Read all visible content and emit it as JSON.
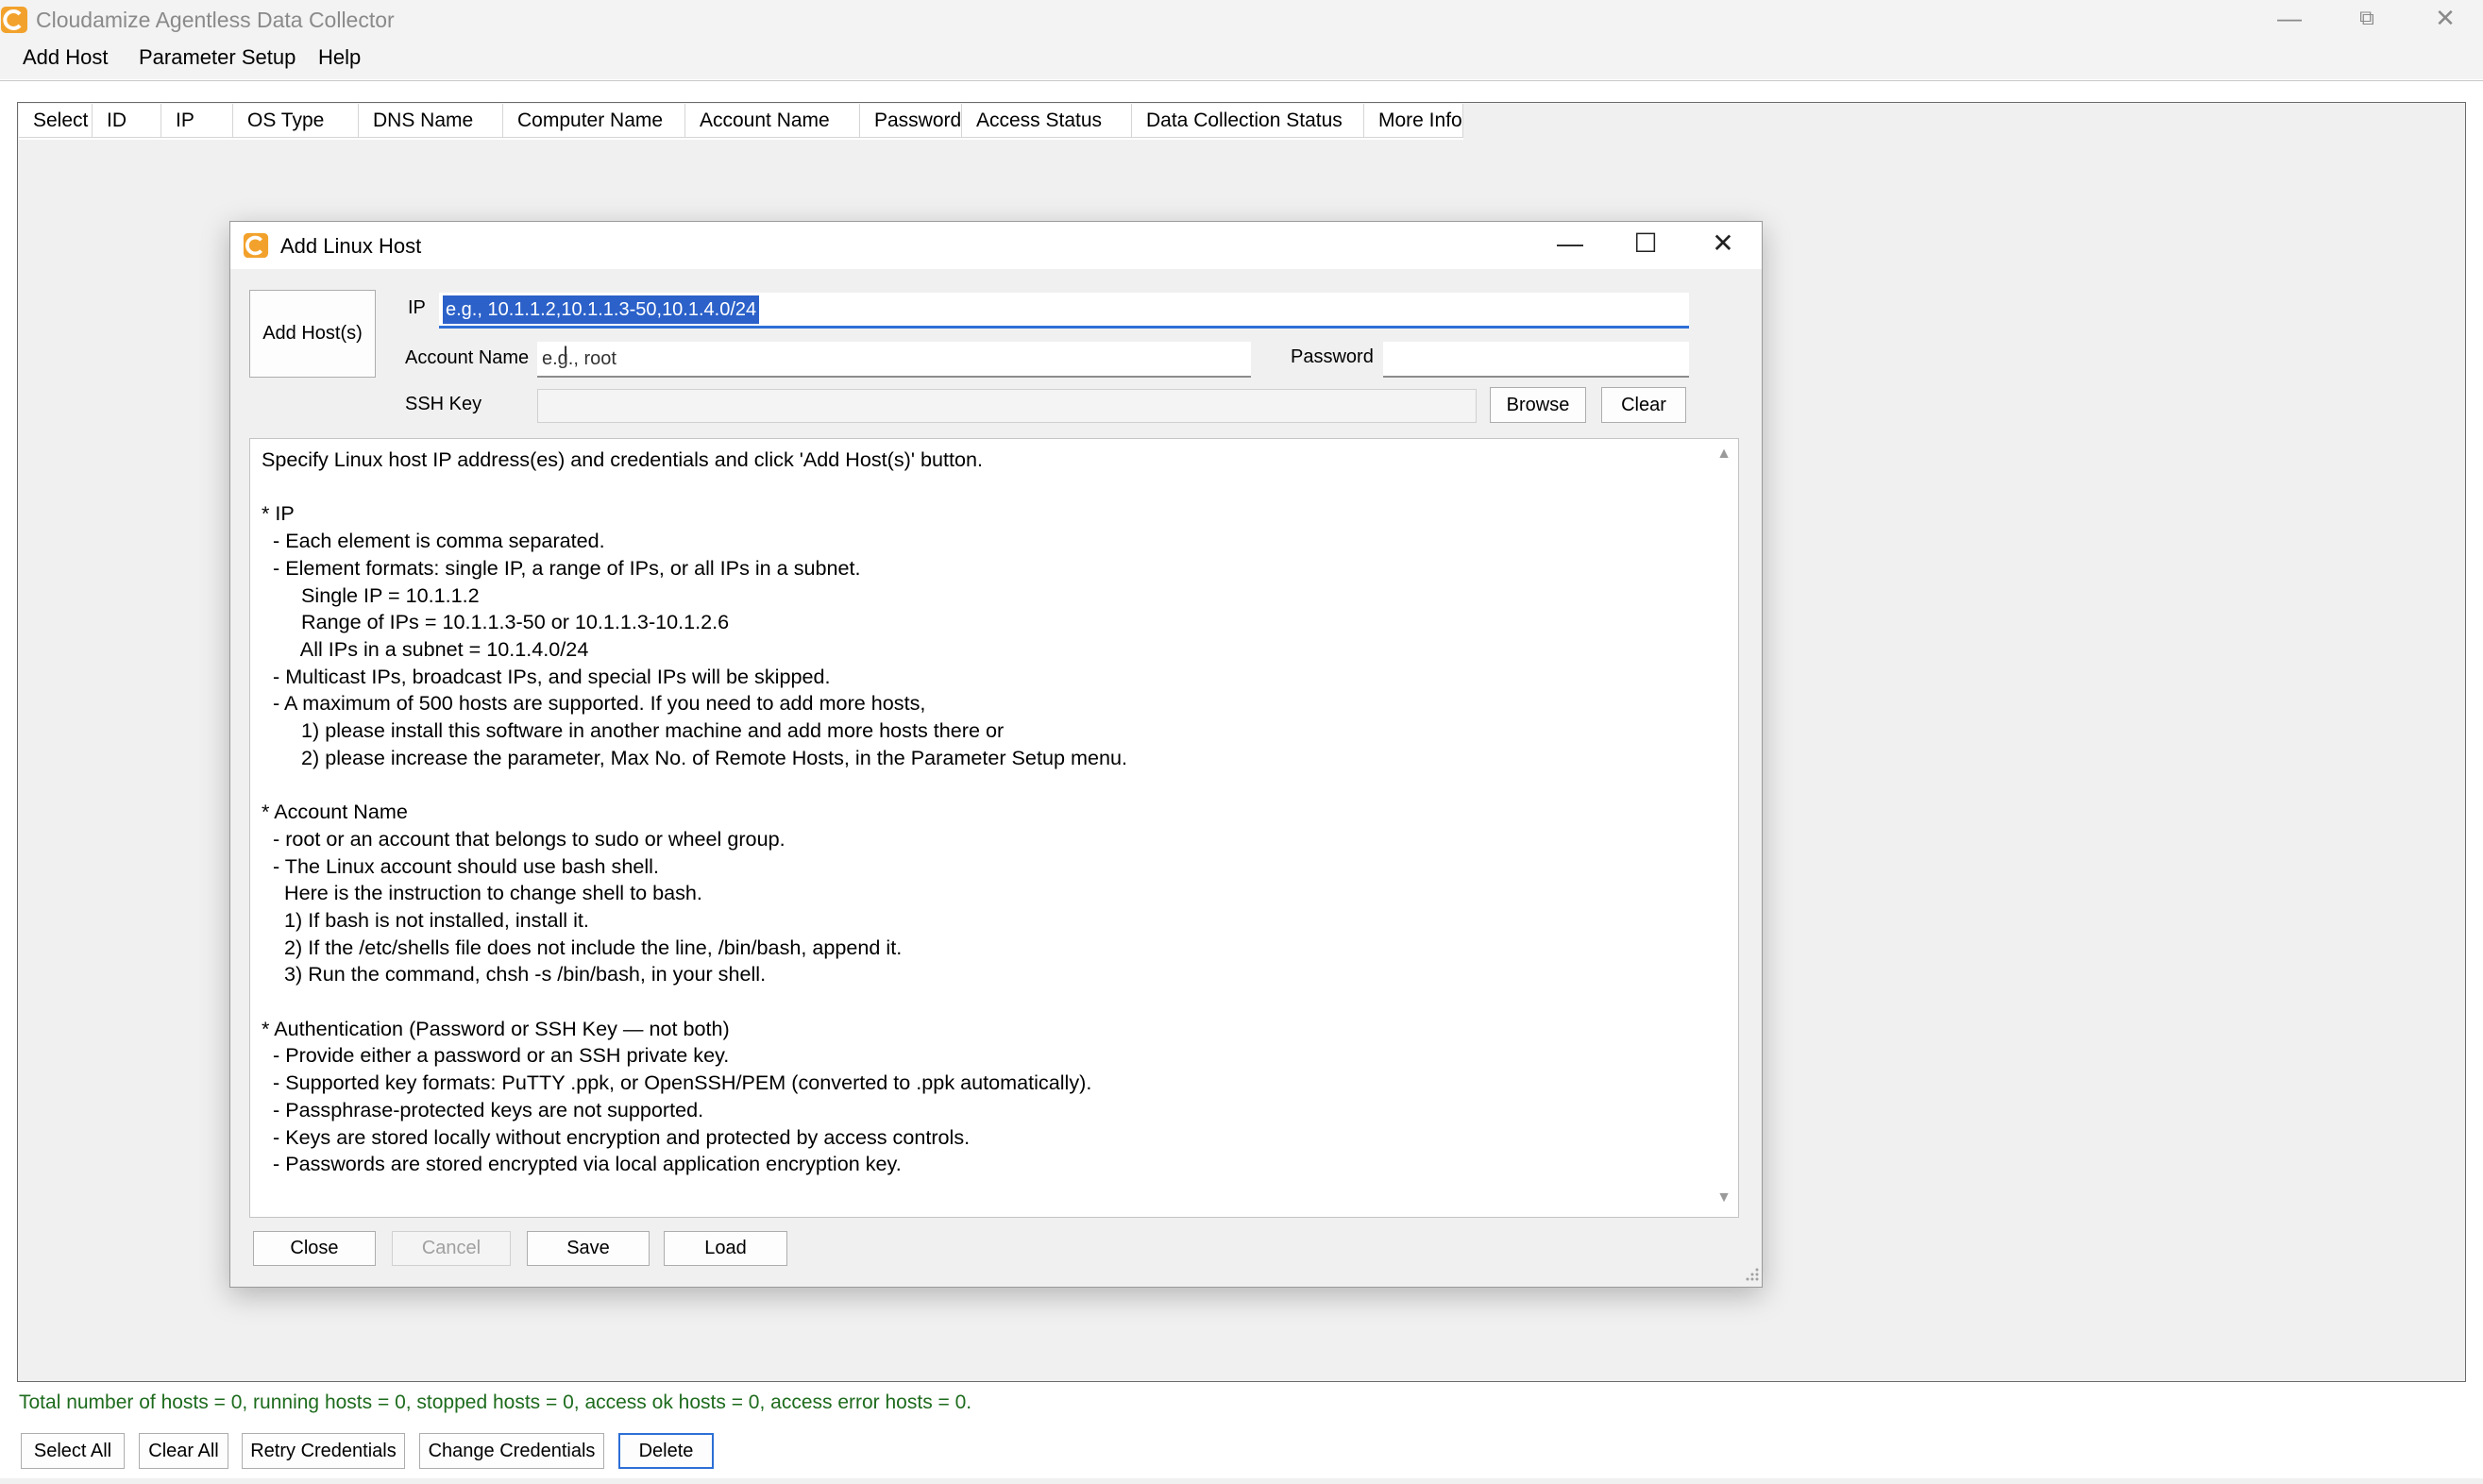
{
  "app": {
    "title": "Cloudamize Agentless Data Collector",
    "window_controls": {
      "minimize": "—",
      "restore": "⧉",
      "close": "✕"
    }
  },
  "menu": [
    "Add Host",
    "Parameter Setup",
    "Help"
  ],
  "grid": {
    "columns": [
      "Select",
      "ID",
      "IP",
      "OS Type",
      "DNS Name",
      "Computer Name",
      "Account Name",
      "Password",
      "Access Status",
      "Data Collection Status",
      "More Info"
    ]
  },
  "status_text": "Total number of hosts = 0, running hosts = 0, stopped hosts = 0, access ok hosts = 0, access error hosts = 0.",
  "bottom_buttons": [
    "Select All",
    "Clear All",
    "Retry Credentials",
    "Change Credentials",
    "Delete"
  ],
  "dialog": {
    "title": "Add Linux Host",
    "add_hosts_button": "Add Host(s)",
    "ip_label": "IP",
    "ip_value": "e.g., 10.1.1.2,10.1.1.3-50,10.1.4.0/24",
    "account_label": "Account Name",
    "account_value": "e.g., root",
    "password_label": "Password",
    "password_value": "",
    "ssh_label": "SSH Key",
    "ssh_value": "",
    "browse_button": "Browse",
    "clear_button": "Clear",
    "help_text": "Specify Linux host IP address(es) and credentials and click 'Add Host(s)' button.\n\n* IP\n  - Each element is comma separated.\n  - Element formats: single IP, a range of IPs, or all IPs in a subnet.\n       Single IP = 10.1.1.2\n       Range of IPs = 10.1.1.3-50 or 10.1.1.3-10.1.2.6\n       All IPs in a subnet = 10.1.4.0/24\n  - Multicast IPs, broadcast IPs, and special IPs will be skipped.\n  - A maximum of 500 hosts are supported. If you need to add more hosts,\n       1) please install this software in another machine and add more hosts there or\n       2) please increase the parameter, Max No. of Remote Hosts, in the Parameter Setup menu.\n\n* Account Name\n  - root or an account that belongs to sudo or wheel group.\n  - The Linux account should use bash shell.\n    Here is the instruction to change shell to bash.\n    1) If bash is not installed, install it.\n    2) If the /etc/shells file does not include the line, /bin/bash, append it.\n    3) Run the command, chsh -s /bin/bash, in your shell.\n\n* Authentication (Password or SSH Key — not both)\n  - Provide either a password or an SSH private key.\n  - Supported key formats: PuTTY .ppk, or OpenSSH/PEM (converted to .ppk automatically).\n  - Passphrase-protected keys are not supported.\n  - Keys are stored locally without encryption and protected by access controls.\n  - Passwords are stored encrypted via local application encryption key.",
    "footer_buttons": [
      "Close",
      "Cancel",
      "Save",
      "Load"
    ],
    "window_controls": {
      "minimize": "—",
      "maximize": "☐",
      "close": "✕"
    }
  },
  "colors": {
    "accent": "#2b61c9",
    "status_green": "#1d6b1d",
    "brand_orange": "#f2a22c"
  }
}
